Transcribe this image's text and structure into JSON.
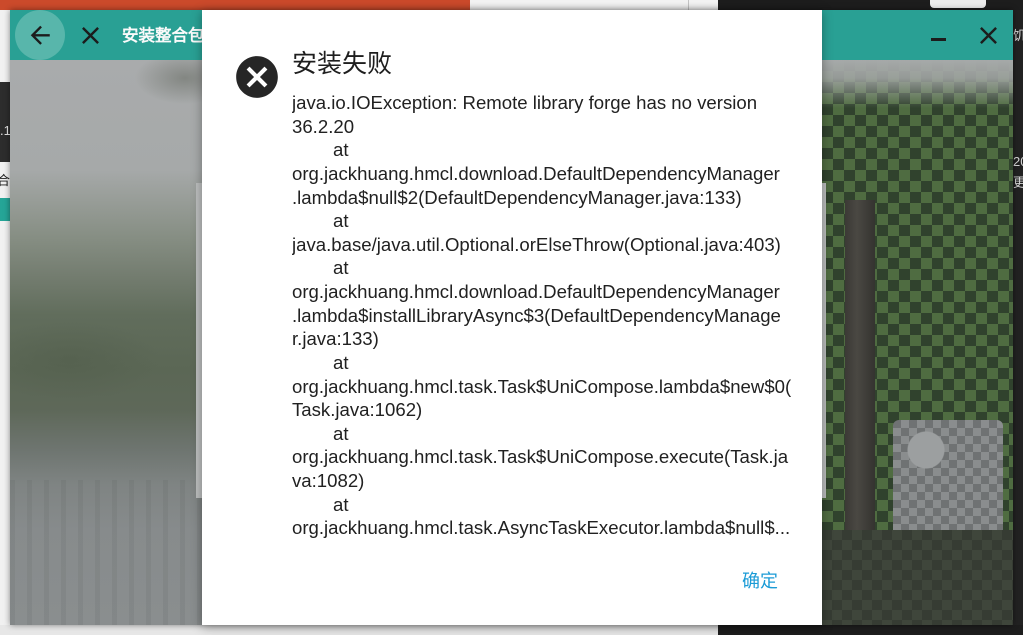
{
  "window": {
    "title": "安装整合包",
    "icons": {
      "back": "arrow-left-icon",
      "close": "close-icon",
      "minimize": "minimize-icon",
      "window_close": "close-icon"
    },
    "colors": {
      "header": "#29a094",
      "back_button": "#58b6ab",
      "header_icons": "#1c1c1c",
      "title_text": "#fafafa"
    }
  },
  "dialog": {
    "icon": "error-icon",
    "title": "安装失败",
    "message_lines": [
      "java.io.IOException: Remote library forge has no version",
      "36.2.20",
      "at",
      "org.jackhuang.hmcl.download.DefaultDependencyManager",
      ".lambda$null$2(DefaultDependencyManager.java:133)",
      "at",
      "java.base/java.util.Optional.orElseThrow(Optional.java:403)",
      "at",
      "org.jackhuang.hmcl.download.DefaultDependencyManager",
      ".lambda$installLibraryAsync$3(DefaultDependencyManage",
      "r.java:133)",
      "at",
      "org.jackhuang.hmcl.task.Task$UniCompose.lambda$new$0(",
      "Task.java:1062)",
      "at",
      "org.jackhuang.hmcl.task.Task$UniCompose.execute(Task.ja",
      "va:1082)",
      "at",
      "org.jackhuang.hmcl.task.AsyncTaskExecutor.lambda$null$..."
    ],
    "confirm_label": "确定",
    "colors": {
      "accent": "#1b9bd6",
      "icon": "#262626",
      "text": "#212121",
      "background": "#ffffff"
    }
  },
  "desktop": {
    "left_fragments": [
      ".1",
      "合"
    ],
    "right_fragments": [
      "饥",
      "20",
      "更"
    ]
  }
}
